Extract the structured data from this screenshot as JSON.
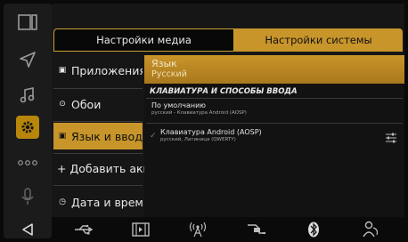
{
  "tabs": {
    "media": "Настройки медиа",
    "system": "Настройки системы"
  },
  "categories": [
    {
      "label": "Приложения",
      "icon": "apps-icon"
    },
    {
      "label": "Обои",
      "icon": "wallpaper-icon"
    },
    {
      "label": "Язык и ввод",
      "icon": "keyboard-icon"
    },
    {
      "label": "+ Добавить аккаунт",
      "icon": ""
    },
    {
      "label": "Дата и время",
      "icon": "clock-icon"
    }
  ],
  "language": {
    "title": "Язык",
    "value": "Русский"
  },
  "section_title": "КЛАВИАТУРА И СПОСОБЫ ВВОДА",
  "default_input": {
    "title": "По умолчанию",
    "subtitle": "русский - Клавиатура Android (AOSP)"
  },
  "keyboard": {
    "title": "Клавиатура Android (AOSP)",
    "subtitle": "русский, Латиница (QWERTY)"
  },
  "colors": {
    "accent": "#c8952a",
    "background": "#0a0a0a"
  }
}
